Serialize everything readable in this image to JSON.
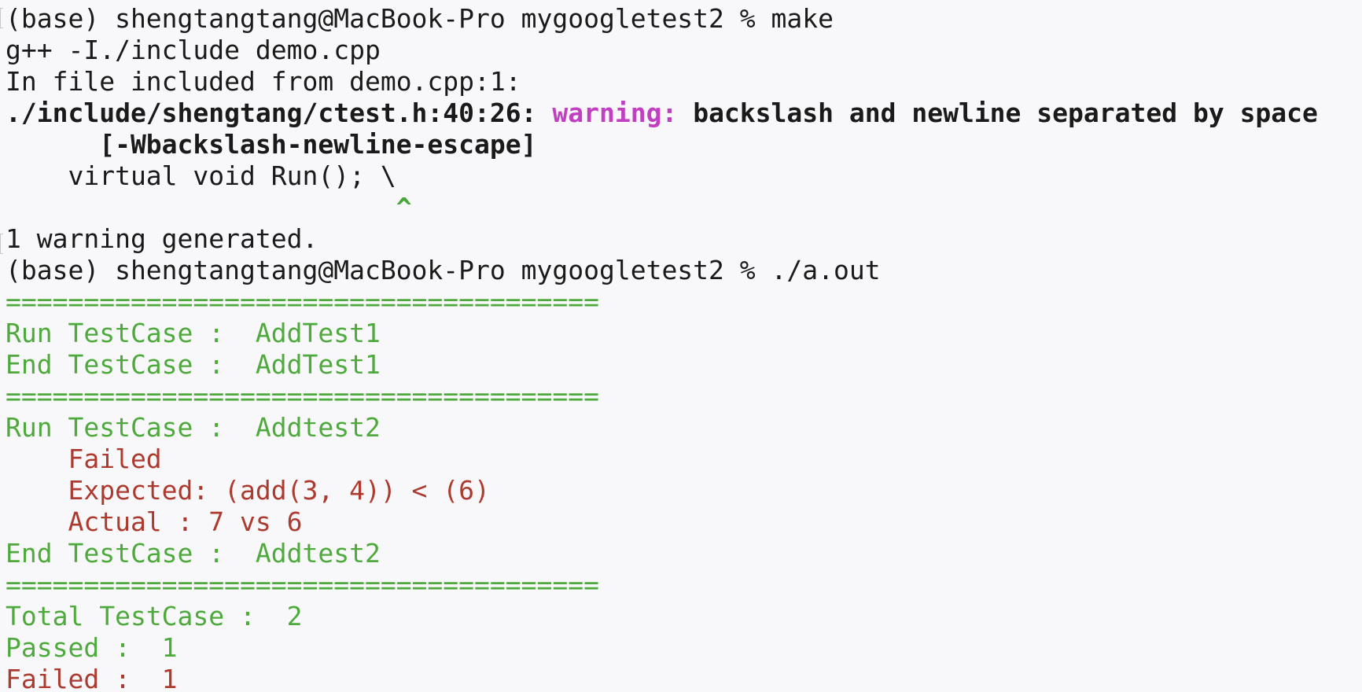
{
  "terminal": {
    "colors": {
      "background": "#f8f8fa",
      "text": "#1a1a1a",
      "warning": "#c13fc1",
      "success": "#4eaa3c",
      "failure": "#ad3a2e"
    },
    "lines": {
      "prompt1": "(base) shengtangtang@MacBook-Pro mygoogletest2 % make",
      "compile": "g++ -I./include demo.cpp",
      "included_from": "In file included from demo.cpp:1:",
      "warn_location": "./include/shengtang/ctest.h:40:26: ",
      "warn_label": "warning:",
      "warn_message": " backslash and newline separated by space",
      "warn_flag": "      [-Wbackslash-newline-escape]",
      "code_line": "    virtual void Run(); \\",
      "caret": "                         ^",
      "warnings_generated": "1 warning generated.",
      "prompt2": "(base) shengtangtang@MacBook-Pro mygoogletest2 % ./a.out",
      "separator": "======================================",
      "run1": "Run TestCase :  AddTest1",
      "end1": "End TestCase :  AddTest1",
      "run2": "Run TestCase :  Addtest2",
      "failed_msg": "    Failed",
      "expected_msg": "    Expected: (add(3, 4)) < (6)",
      "actual_msg": "    Actual : 7 vs 6",
      "end2": "End TestCase :  Addtest2",
      "total": "Total TestCase :  2",
      "passed": "Passed :  1",
      "failed": "Failed :  1"
    }
  }
}
